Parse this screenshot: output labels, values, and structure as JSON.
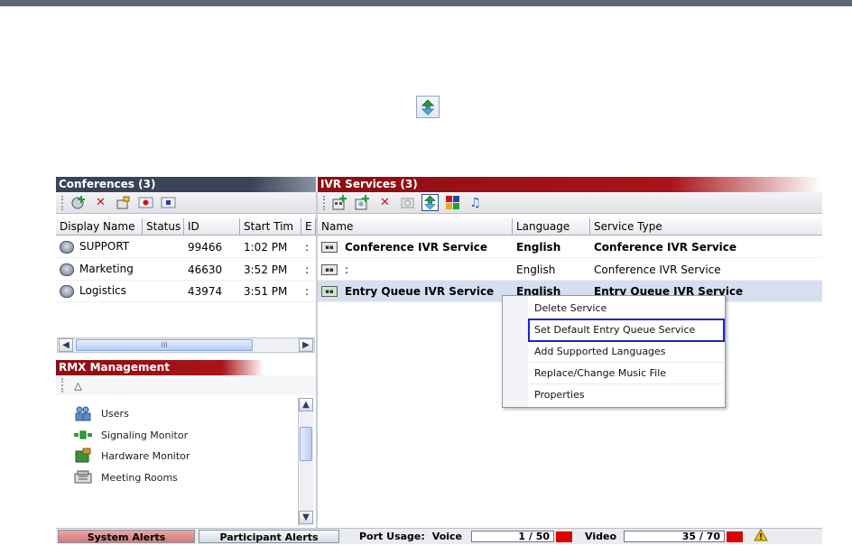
{
  "conferences_panel": {
    "title": "Conferences (3)",
    "columns": [
      "Display Name",
      "Status",
      "ID",
      "Start Tim",
      "E"
    ],
    "rows": [
      {
        "name": "SUPPORT",
        "status": "",
        "id": "99466",
        "start": "1:02 PM",
        "e": ":"
      },
      {
        "name": "Marketing",
        "status": "",
        "id": "46630",
        "start": "3:52 PM",
        "e": ":"
      },
      {
        "name": "Logistics",
        "status": "",
        "id": "43974",
        "start": "3:51 PM",
        "e": ":"
      }
    ],
    "scroll_thumb_label": "III"
  },
  "ivr_panel": {
    "title": "IVR Services (3)",
    "columns": [
      "Name",
      "Language",
      "Service Type"
    ],
    "rows": [
      {
        "name": "Conference IVR Service",
        "language": "English",
        "type": "Conference IVR Service",
        "bold": true,
        "selected": false
      },
      {
        "name": ":",
        "language": "English",
        "type": "Conference IVR Service",
        "bold": false,
        "selected": false
      },
      {
        "name": "Entry Queue IVR Service",
        "language": "English",
        "type": "Entry Queue IVR Service",
        "bold": true,
        "selected": true
      }
    ]
  },
  "rmx_panel": {
    "title": "RMX Management",
    "items": [
      {
        "label": "Users",
        "icon": "users-icon"
      },
      {
        "label": "Signaling Monitor",
        "icon": "signaling-monitor-icon"
      },
      {
        "label": "Hardware Monitor",
        "icon": "hardware-monitor-icon"
      },
      {
        "label": "Meeting Rooms",
        "icon": "meeting-rooms-icon"
      }
    ]
  },
  "context_menu": {
    "items": [
      {
        "label": "Delete Service",
        "highlighted": false
      },
      {
        "label": "Set Default Entry Queue Service",
        "highlighted": true
      },
      {
        "label": "Add Supported Languages",
        "highlighted": false
      },
      {
        "label": "Replace/Change Music File",
        "highlighted": false
      },
      {
        "label": "Properties",
        "highlighted": false
      }
    ]
  },
  "status_bar": {
    "system_alerts": "System Alerts",
    "participant_alerts": "Participant Alerts",
    "port_usage_label": "Port Usage:",
    "voice_label": "Voice",
    "voice_value": "1 / 50",
    "video_label": "Video",
    "video_value": "35 / 70"
  },
  "colors": {
    "ivr_title": "#a81419",
    "conf_title": "#3a4456",
    "highlight_border": "#1a26c9",
    "selected_row": "#d6dff0",
    "alert_red": "#e00000"
  }
}
